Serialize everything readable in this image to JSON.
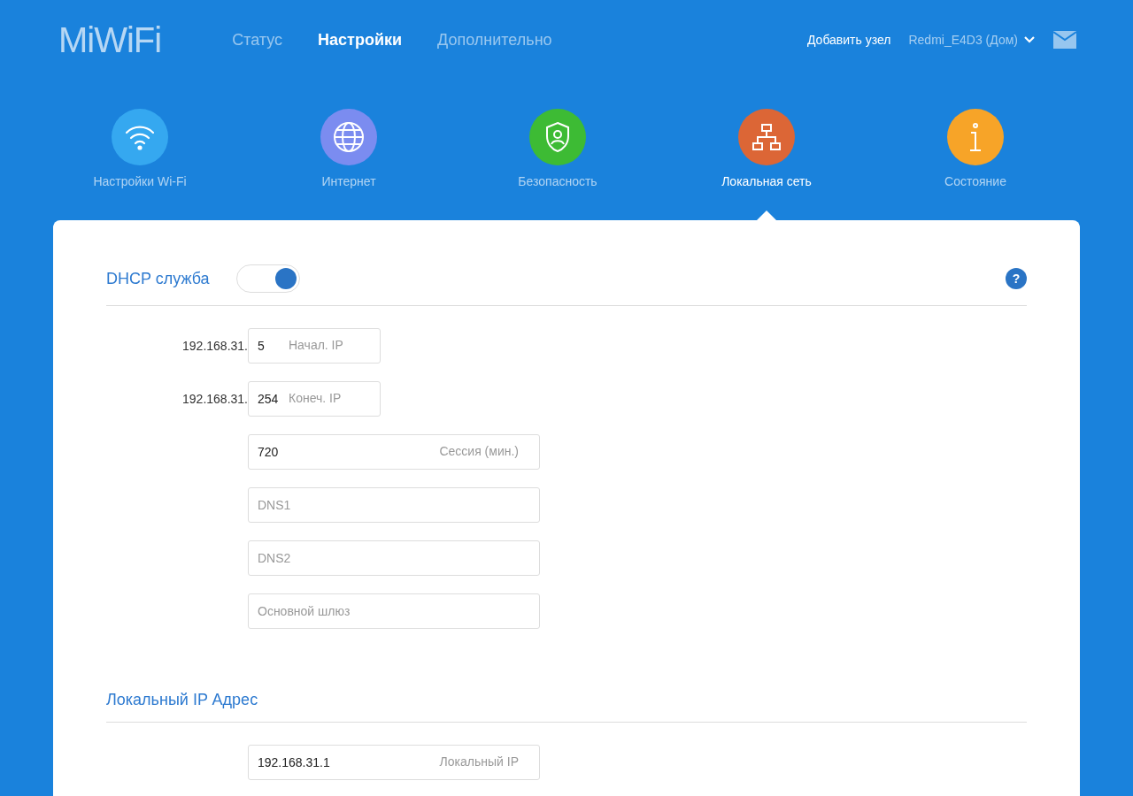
{
  "header": {
    "logo": "MiWiFi",
    "nav": [
      {
        "label": "Статус",
        "selected": false
      },
      {
        "label": "Настройки",
        "selected": true
      },
      {
        "label": "Дополнительно",
        "selected": false
      }
    ],
    "add_node": "Добавить узел",
    "device": "Redmi_E4D3 (Дом)"
  },
  "categories": [
    {
      "kind": "wifi",
      "label": "Настройки Wi-Fi",
      "color": "#35a8f0",
      "selected": false
    },
    {
      "kind": "globe",
      "label": "Интернет",
      "color": "#7b8cf0",
      "selected": false
    },
    {
      "kind": "shield",
      "label": "Безопасность",
      "color": "#3dbb34",
      "selected": false
    },
    {
      "kind": "network",
      "label": "Локальная сеть",
      "color": "#dc6636",
      "selected": true
    },
    {
      "kind": "info",
      "label": "Состояние",
      "color": "#f7a428",
      "selected": false
    }
  ],
  "sections": [
    {
      "title": "DHCP служба",
      "toggle": {
        "on": true
      },
      "help": "?",
      "fields": [
        {
          "kind": "short",
          "prefix": "192.168.31.",
          "value": "5",
          "label": "Начал. IP"
        },
        {
          "kind": "short",
          "prefix": "192.168.31.",
          "value": "254",
          "label": "Конеч. IP"
        },
        {
          "kind": "long",
          "value": "720",
          "label": "Сессия (мин.)"
        },
        {
          "kind": "long",
          "placeholder": "DNS1"
        },
        {
          "kind": "long",
          "placeholder": "DNS2"
        },
        {
          "kind": "long",
          "placeholder": "Основной шлюз"
        }
      ]
    },
    {
      "title": "Локальный IP Адрес",
      "fields": [
        {
          "kind": "long",
          "value": "192.168.31.1",
          "label": "Локальный IP"
        }
      ]
    }
  ]
}
